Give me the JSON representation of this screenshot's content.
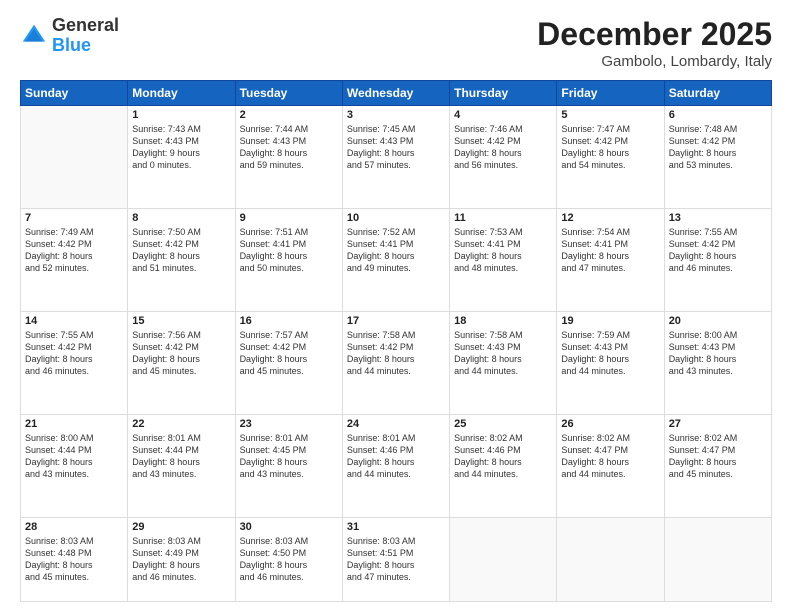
{
  "logo": {
    "general": "General",
    "blue": "Blue"
  },
  "title": "December 2025",
  "subtitle": "Gambolo, Lombardy, Italy",
  "weekdays": [
    "Sunday",
    "Monday",
    "Tuesday",
    "Wednesday",
    "Thursday",
    "Friday",
    "Saturday"
  ],
  "weeks": [
    [
      {
        "day": "",
        "info": ""
      },
      {
        "day": "1",
        "info": "Sunrise: 7:43 AM\nSunset: 4:43 PM\nDaylight: 9 hours\nand 0 minutes."
      },
      {
        "day": "2",
        "info": "Sunrise: 7:44 AM\nSunset: 4:43 PM\nDaylight: 8 hours\nand 59 minutes."
      },
      {
        "day": "3",
        "info": "Sunrise: 7:45 AM\nSunset: 4:43 PM\nDaylight: 8 hours\nand 57 minutes."
      },
      {
        "day": "4",
        "info": "Sunrise: 7:46 AM\nSunset: 4:42 PM\nDaylight: 8 hours\nand 56 minutes."
      },
      {
        "day": "5",
        "info": "Sunrise: 7:47 AM\nSunset: 4:42 PM\nDaylight: 8 hours\nand 54 minutes."
      },
      {
        "day": "6",
        "info": "Sunrise: 7:48 AM\nSunset: 4:42 PM\nDaylight: 8 hours\nand 53 minutes."
      }
    ],
    [
      {
        "day": "7",
        "info": "Sunrise: 7:49 AM\nSunset: 4:42 PM\nDaylight: 8 hours\nand 52 minutes."
      },
      {
        "day": "8",
        "info": "Sunrise: 7:50 AM\nSunset: 4:42 PM\nDaylight: 8 hours\nand 51 minutes."
      },
      {
        "day": "9",
        "info": "Sunrise: 7:51 AM\nSunset: 4:41 PM\nDaylight: 8 hours\nand 50 minutes."
      },
      {
        "day": "10",
        "info": "Sunrise: 7:52 AM\nSunset: 4:41 PM\nDaylight: 8 hours\nand 49 minutes."
      },
      {
        "day": "11",
        "info": "Sunrise: 7:53 AM\nSunset: 4:41 PM\nDaylight: 8 hours\nand 48 minutes."
      },
      {
        "day": "12",
        "info": "Sunrise: 7:54 AM\nSunset: 4:41 PM\nDaylight: 8 hours\nand 47 minutes."
      },
      {
        "day": "13",
        "info": "Sunrise: 7:55 AM\nSunset: 4:42 PM\nDaylight: 8 hours\nand 46 minutes."
      }
    ],
    [
      {
        "day": "14",
        "info": "Sunrise: 7:55 AM\nSunset: 4:42 PM\nDaylight: 8 hours\nand 46 minutes."
      },
      {
        "day": "15",
        "info": "Sunrise: 7:56 AM\nSunset: 4:42 PM\nDaylight: 8 hours\nand 45 minutes."
      },
      {
        "day": "16",
        "info": "Sunrise: 7:57 AM\nSunset: 4:42 PM\nDaylight: 8 hours\nand 45 minutes."
      },
      {
        "day": "17",
        "info": "Sunrise: 7:58 AM\nSunset: 4:42 PM\nDaylight: 8 hours\nand 44 minutes."
      },
      {
        "day": "18",
        "info": "Sunrise: 7:58 AM\nSunset: 4:43 PM\nDaylight: 8 hours\nand 44 minutes."
      },
      {
        "day": "19",
        "info": "Sunrise: 7:59 AM\nSunset: 4:43 PM\nDaylight: 8 hours\nand 44 minutes."
      },
      {
        "day": "20",
        "info": "Sunrise: 8:00 AM\nSunset: 4:43 PM\nDaylight: 8 hours\nand 43 minutes."
      }
    ],
    [
      {
        "day": "21",
        "info": "Sunrise: 8:00 AM\nSunset: 4:44 PM\nDaylight: 8 hours\nand 43 minutes."
      },
      {
        "day": "22",
        "info": "Sunrise: 8:01 AM\nSunset: 4:44 PM\nDaylight: 8 hours\nand 43 minutes."
      },
      {
        "day": "23",
        "info": "Sunrise: 8:01 AM\nSunset: 4:45 PM\nDaylight: 8 hours\nand 43 minutes."
      },
      {
        "day": "24",
        "info": "Sunrise: 8:01 AM\nSunset: 4:46 PM\nDaylight: 8 hours\nand 44 minutes."
      },
      {
        "day": "25",
        "info": "Sunrise: 8:02 AM\nSunset: 4:46 PM\nDaylight: 8 hours\nand 44 minutes."
      },
      {
        "day": "26",
        "info": "Sunrise: 8:02 AM\nSunset: 4:47 PM\nDaylight: 8 hours\nand 44 minutes."
      },
      {
        "day": "27",
        "info": "Sunrise: 8:02 AM\nSunset: 4:47 PM\nDaylight: 8 hours\nand 45 minutes."
      }
    ],
    [
      {
        "day": "28",
        "info": "Sunrise: 8:03 AM\nSunset: 4:48 PM\nDaylight: 8 hours\nand 45 minutes."
      },
      {
        "day": "29",
        "info": "Sunrise: 8:03 AM\nSunset: 4:49 PM\nDaylight: 8 hours\nand 46 minutes."
      },
      {
        "day": "30",
        "info": "Sunrise: 8:03 AM\nSunset: 4:50 PM\nDaylight: 8 hours\nand 46 minutes."
      },
      {
        "day": "31",
        "info": "Sunrise: 8:03 AM\nSunset: 4:51 PM\nDaylight: 8 hours\nand 47 minutes."
      },
      {
        "day": "",
        "info": ""
      },
      {
        "day": "",
        "info": ""
      },
      {
        "day": "",
        "info": ""
      }
    ]
  ]
}
